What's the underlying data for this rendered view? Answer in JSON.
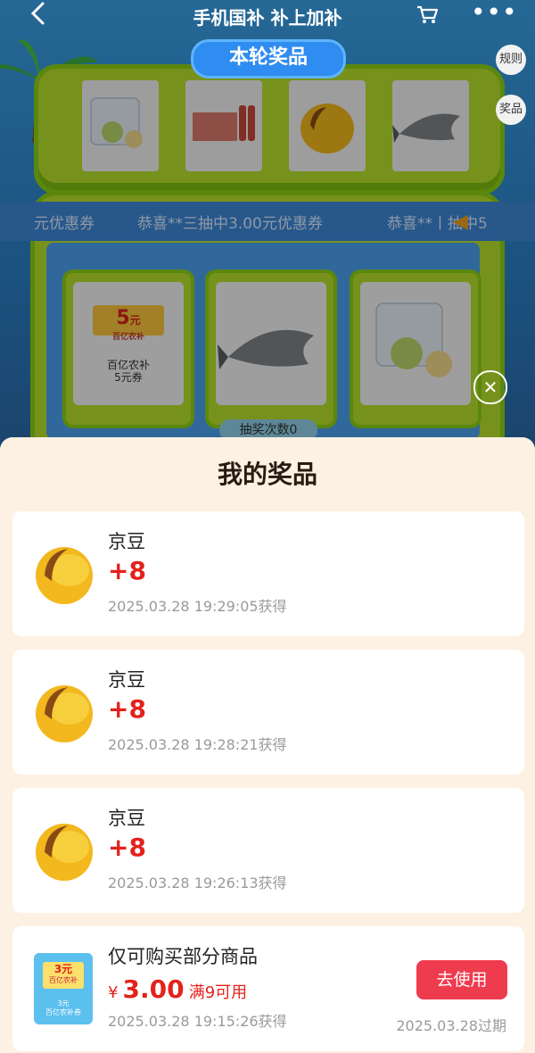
{
  "header": {
    "back_icon": "chevron-left-icon",
    "title": "手机国补 补上加补",
    "cart_icon": "cart-icon",
    "more_icon": "more-dots-icon",
    "more_glyph": "•••"
  },
  "game": {
    "round_prizes_label": "本轮奖品",
    "rules_label": "规则",
    "prizes_label": "奖品",
    "ticker_items": [
      "元优惠券",
      "恭喜**三抽中3.00元优惠券",
      "恭喜**丨抽中5"
    ],
    "cards": {
      "coupon_value": "5",
      "coupon_unit": "元",
      "coupon_tag": "百亿农补",
      "coupon_caption_1": "百亿农补",
      "coupon_caption_2": "5元券"
    },
    "draw_count_label": "抽奖次数0",
    "close_glyph": "✕"
  },
  "sheet": {
    "title": "我的奖品",
    "items": [
      {
        "name": "京豆",
        "amount": "+8",
        "time": "2025.03.28 19:29:05获得"
      },
      {
        "name": "京豆",
        "amount": "+8",
        "time": "2025.03.28 19:28:21获得"
      },
      {
        "name": "京豆",
        "amount": "+8",
        "time": "2025.03.28 19:26:13获得"
      }
    ],
    "coupon": {
      "name": "仅可购买部分商品",
      "currency": "¥",
      "value": "3.00",
      "condition": "满9可用",
      "time": "2025.03.28 19:15:26获得",
      "button": "去使用",
      "expire": "2025.03.28过期",
      "icon_value": "3元",
      "icon_tag": "百亿农补",
      "icon_caption_1": "3元",
      "icon_caption_2": "百亿农补券"
    }
  },
  "colors": {
    "accent_red": "#e3221c",
    "button_red": "#ef3b4e",
    "sheet_bg": "#fdf1e3",
    "machine_green": "#b6e02b"
  }
}
